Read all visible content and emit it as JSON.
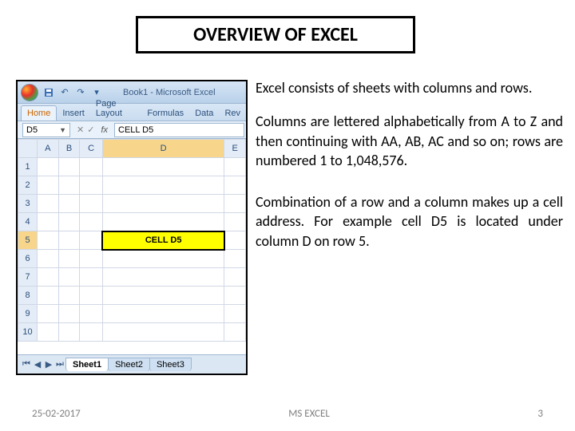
{
  "title": "OVERVIEW OF EXCEL",
  "excel": {
    "window_title": "Book1 - Microsoft Excel",
    "tabs": {
      "home": "Home",
      "insert": "Insert",
      "page_layout": "Page Layout",
      "formulas": "Formulas",
      "data": "Data",
      "review": "Rev"
    },
    "name_box": "D5",
    "fx_label": "fx",
    "formula_bar": "CELL D5",
    "columns": [
      "A",
      "B",
      "C",
      "D",
      "E"
    ],
    "rows": [
      "1",
      "2",
      "3",
      "4",
      "5",
      "6",
      "7",
      "8",
      "9",
      "10"
    ],
    "selected_cell_text": "CELL D5",
    "sheets": {
      "s1": "Sheet1",
      "s2": "Sheet2",
      "s3": "Sheet3"
    }
  },
  "paras": {
    "p1": "Excel consists of sheets with columns and rows.",
    "p2": "Columns are lettered alphabetically from A to Z and then continuing with AA, AB, AC and so on; rows are numbered 1 to 1,048,576.",
    "p3": "Combination of a row and a column makes up a cell address. For example cell D5 is located under column D on row 5."
  },
  "footer": {
    "date": "25-02-2017",
    "center": "MS EXCEL",
    "page": "3"
  }
}
